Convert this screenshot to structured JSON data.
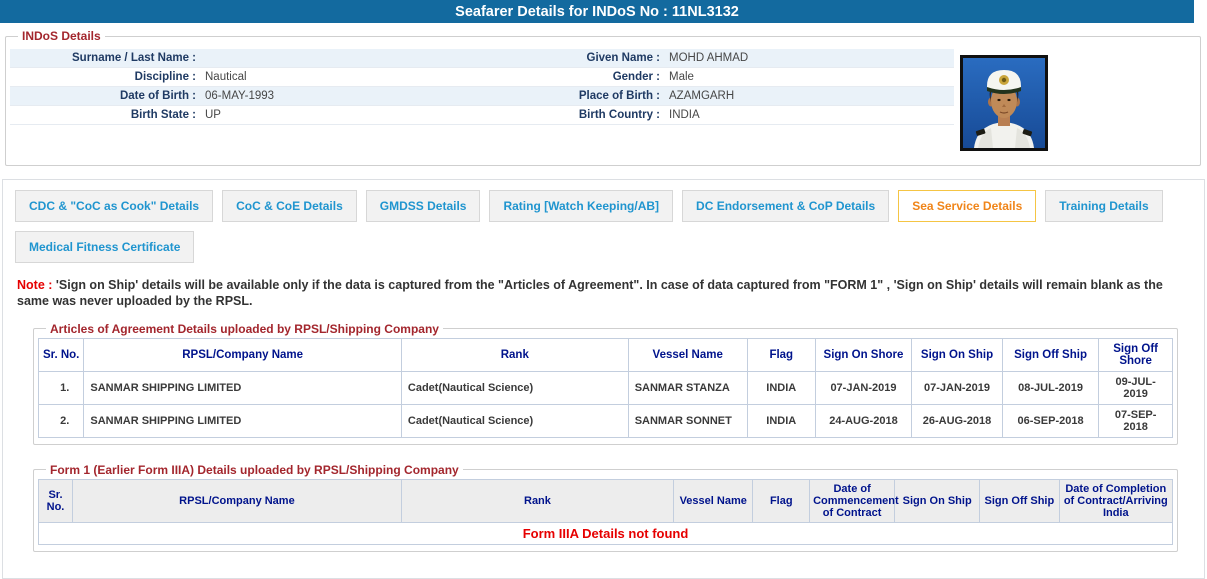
{
  "title": "Seafarer Details for INDoS No : 11NL3132",
  "colors": {
    "title_bar_bg": "#136a9f",
    "stripe_blue": "#eaf2f9",
    "field_label_navy": "#1f3a63",
    "table_header_navy": "#00138c",
    "legend_red": "#a3262d",
    "note_red": "#e60000",
    "tab_text_blue": "#2095cf",
    "active_tab_text": "#f08519",
    "active_tab_border": "#f5c544"
  },
  "indos": {
    "legend": "INDoS Details",
    "rows": [
      {
        "l1": "Surname / Last Name :",
        "v1": "",
        "l2": "Given Name :",
        "v2": "MOHD AHMAD"
      },
      {
        "l1": "Discipline :",
        "v1": "Nautical",
        "l2": "Gender :",
        "v2": "Male"
      },
      {
        "l1": "Date of Birth :",
        "v1": "06-MAY-1993",
        "l2": "Place of Birth :",
        "v2": "AZAMGARH"
      },
      {
        "l1": "Birth State :",
        "v1": "UP",
        "l2": "Birth Country :",
        "v2": "INDIA"
      }
    ],
    "photo": "seafarer-photo"
  },
  "tabs": [
    {
      "label": "CDC & \"CoC as Cook\" Details",
      "active": false
    },
    {
      "label": "CoC & CoE Details",
      "active": false
    },
    {
      "label": "GMDSS Details",
      "active": false
    },
    {
      "label": "Rating [Watch Keeping/AB]",
      "active": false
    },
    {
      "label": "DC Endorsement & CoP Details",
      "active": false
    },
    {
      "label": "Sea Service Details",
      "active": true
    },
    {
      "label": "Training Details",
      "active": false
    },
    {
      "label": "Medical Fitness Certificate",
      "active": false
    }
  ],
  "note": {
    "prefix": "Note :",
    "text": "'Sign on Ship' details will be available only if the data is captured from the \"Articles of Agreement\". In case of data captured from \"FORM 1\" , 'Sign on Ship' details will remain blank as the same was never uploaded by the RPSL."
  },
  "aoa": {
    "legend": "Articles of Agreement Details uploaded by RPSL/Shipping Company",
    "headers": [
      "Sr. No.",
      "RPSL/Company Name",
      "Rank",
      "Vessel Name",
      "Flag",
      "Sign On Shore",
      "Sign On Ship",
      "Sign Off Ship",
      "Sign Off Shore"
    ],
    "rows": [
      [
        "1.",
        "SANMAR SHIPPING LIMITED",
        "Cadet(Nautical Science)",
        "SANMAR STANZA",
        "INDIA",
        "07-JAN-2019",
        "07-JAN-2019",
        "08-JUL-2019",
        "09-JUL-2019"
      ],
      [
        "2.",
        "SANMAR SHIPPING LIMITED",
        "Cadet(Nautical Science)",
        "SANMAR SONNET",
        "INDIA",
        "24-AUG-2018",
        "26-AUG-2018",
        "06-SEP-2018",
        "07-SEP-2018"
      ]
    ]
  },
  "form1": {
    "legend": "Form 1 (Earlier Form IIIA) Details uploaded by RPSL/Shipping Company",
    "headers": [
      "Sr. No.",
      "RPSL/Company Name",
      "Rank",
      "Vessel Name",
      "Flag",
      "Date of Commencement of Contract",
      "Sign On Ship",
      "Sign Off Ship",
      "Date of Completion of Contract/Arriving India"
    ],
    "empty_message": "Form IIIA Details not found"
  }
}
